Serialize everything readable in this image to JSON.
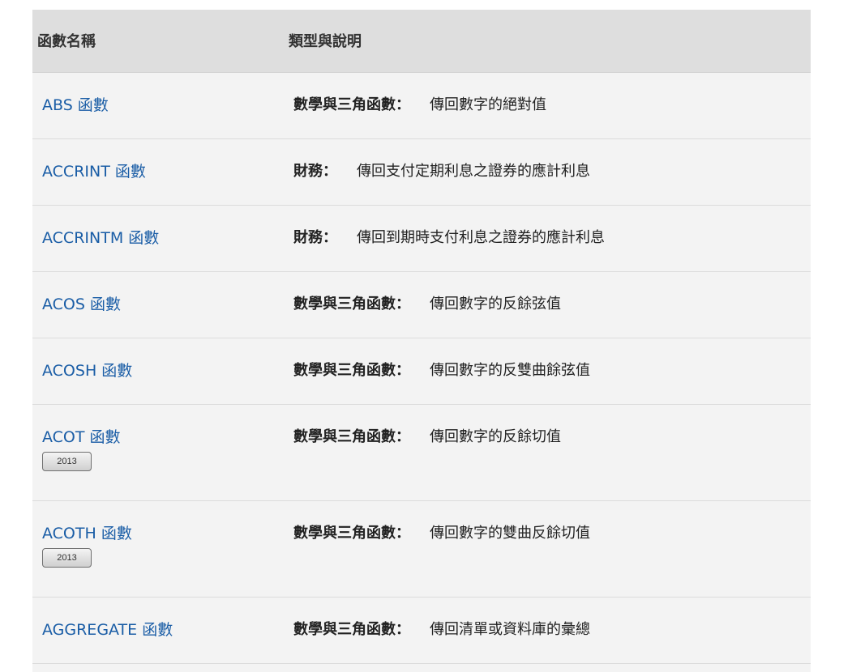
{
  "header": {
    "col_name": "函數名稱",
    "col_desc": "類型與說明"
  },
  "rows": [
    {
      "name": "ABS 函數",
      "category": "數學與三角函數",
      "colon": "：",
      "description": "傳回數字的絕對值"
    },
    {
      "name": "ACCRINT 函數",
      "category": "財務",
      "colon": "：",
      "description": "傳回支付定期利息之證券的應計利息"
    },
    {
      "name": "ACCRINTM 函數",
      "category": "財務",
      "colon": "：",
      "description": "傳回到期時支付利息之證券的應計利息"
    },
    {
      "name": "ACOS 函數",
      "category": "數學與三角函數",
      "colon": "：",
      "description": "傳回數字的反餘弦值"
    },
    {
      "name": "ACOSH 函數",
      "category": "數學與三角函數",
      "colon": "：",
      "description": "傳回數字的反雙曲餘弦值"
    },
    {
      "name": "ACOT 函數",
      "badge": "2013",
      "category": "數學與三角函數",
      "colon": "：",
      "description": "傳回數字的反餘切值"
    },
    {
      "name": "ACOTH 函數",
      "badge": "2013",
      "category": "數學與三角函數",
      "colon": "：",
      "description": "傳回數字的雙曲反餘切值"
    },
    {
      "name": "AGGREGATE 函數",
      "category": "數學與三角函數",
      "colon": "：",
      "description": "傳回清單或資料庫的彙總"
    }
  ],
  "colors": {
    "link": "#1a5da6",
    "header_bg": "#dedede",
    "row_bg": "#f3f3f3"
  }
}
